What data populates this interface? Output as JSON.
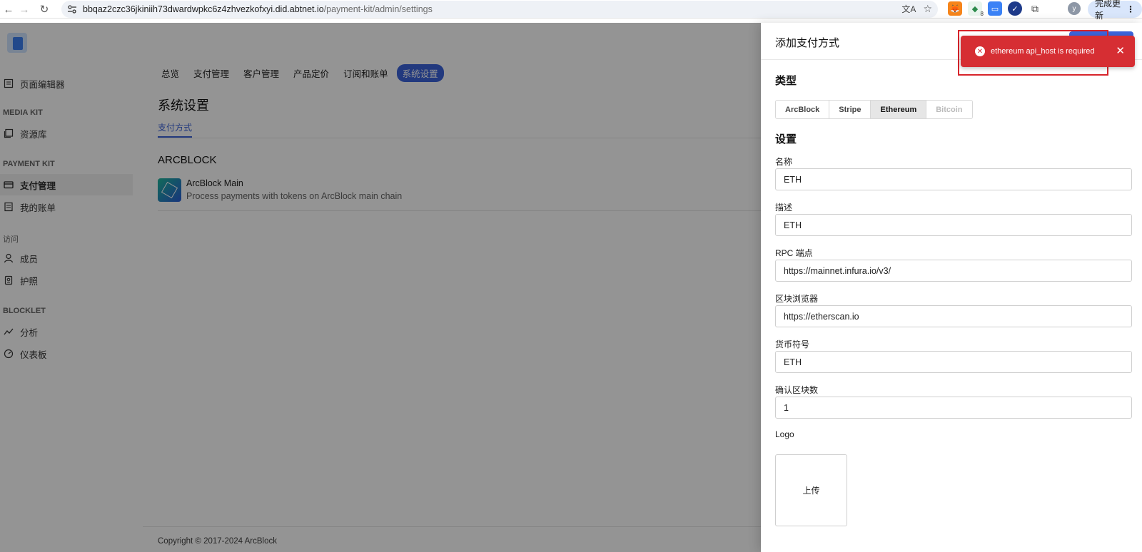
{
  "browser": {
    "url_host": "bbqaz2czc36jkiniih73dwardwpkc6z4zhvezkofxyi.did.abtnet.io",
    "url_path": "/payment-kit/admin/settings",
    "profile_initial": "y",
    "update_label": "完成更新",
    "ext_badge": "8"
  },
  "sidebar": {
    "items_top": [
      {
        "label": "页面编辑器",
        "icon": "page-icon"
      }
    ],
    "section1": "MEDIA KIT",
    "media_items": [
      {
        "label": "资源库",
        "icon": "library-icon"
      }
    ],
    "section2": "PAYMENT KIT",
    "payment_items": [
      {
        "label": "支付管理",
        "icon": "card-icon",
        "active": true
      },
      {
        "label": "我的账单",
        "icon": "bill-icon"
      }
    ],
    "section3": "访问",
    "access_items": [
      {
        "label": "成员",
        "icon": "user-icon"
      },
      {
        "label": "护照",
        "icon": "passport-icon"
      }
    ],
    "section4": "BLOCKLET",
    "blocklet_items": [
      {
        "label": "分析",
        "icon": "chart-icon"
      },
      {
        "label": "仪表板",
        "icon": "gauge-icon"
      }
    ]
  },
  "topnav": {
    "tabs": [
      "总览",
      "支付管理",
      "客户管理",
      "产品定价",
      "订阅和账单",
      "系统设置"
    ],
    "active_index": 5
  },
  "main": {
    "title": "系统设置",
    "subtab": "支付方式",
    "section_heading": "ARCBLOCK",
    "method_title": "ArcBlock Main",
    "method_desc": "Process payments with tokens on ArcBlock main chain",
    "footer": "Copyright © 2017-2024  ArcBlock"
  },
  "drawer": {
    "title": "添加支付方式",
    "type_heading": "类型",
    "types": [
      "ArcBlock",
      "Stripe",
      "Ethereum",
      "Bitcoin"
    ],
    "selected_type": "Ethereum",
    "disabled_type": "Bitcoin",
    "settings_heading": "设置",
    "fields": [
      {
        "label": "名称",
        "value": "ETH"
      },
      {
        "label": "描述",
        "value": "ETH"
      },
      {
        "label": "RPC 端点",
        "value": "https://mainnet.infura.io/v3/"
      },
      {
        "label": "区块浏览器",
        "value": "https://etherscan.io"
      },
      {
        "label": "货币符号",
        "value": "ETH"
      },
      {
        "label": "确认区块数",
        "value": "1"
      }
    ],
    "logo_label": "Logo",
    "upload_label": "上传"
  },
  "toast": {
    "message": "ethereum api_host is required",
    "color": "#d62e33"
  }
}
